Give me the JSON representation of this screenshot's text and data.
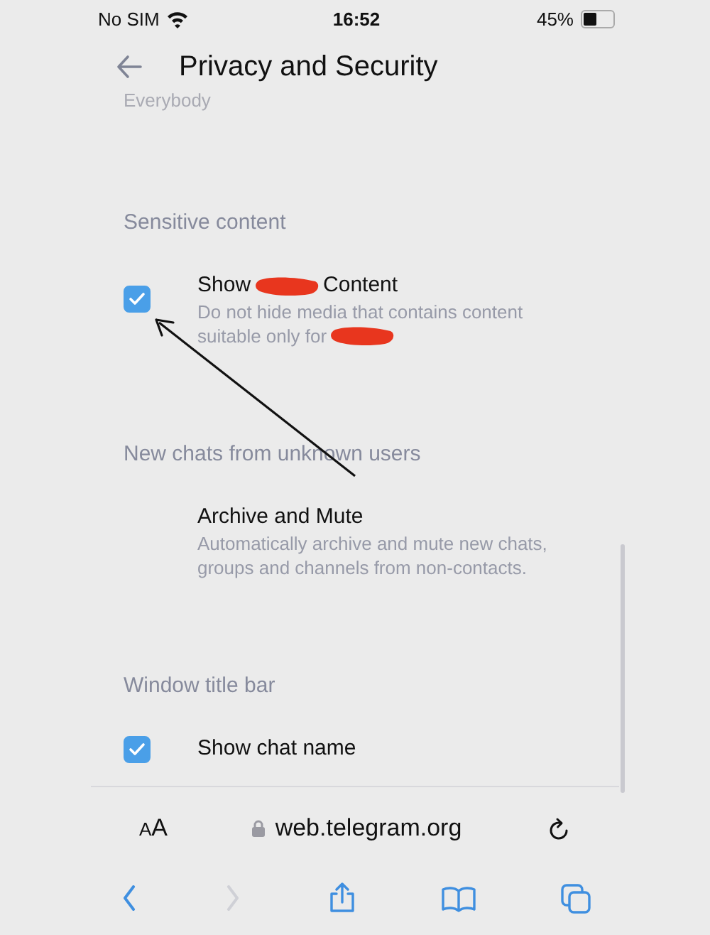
{
  "status_bar": {
    "carrier": "No SIM",
    "time": "16:52",
    "battery": "45%"
  },
  "header": {
    "title": "Privacy and Security"
  },
  "previous_value": "Everybody",
  "sections": [
    {
      "title": "Sensitive content",
      "items": [
        {
          "kind": "checkbox",
          "checked": true,
          "redacted": true,
          "title": [
            "Show",
            "Content"
          ],
          "description": [
            "Do not hide media that contains content",
            "suitable only for"
          ]
        }
      ]
    },
    {
      "title": "New chats from unknown users",
      "items": [
        {
          "kind": "option",
          "title": [
            "Archive and Mute"
          ],
          "description": [
            "Automatically archive and mute new chats,",
            "groups and channels from non-contacts."
          ]
        }
      ]
    },
    {
      "title": "Window title bar",
      "items": [
        {
          "kind": "checkbox",
          "checked": true,
          "title": [
            "Show chat name"
          ]
        }
      ]
    }
  ],
  "browser": {
    "text_size": "AA",
    "url": "web.telegram.org"
  }
}
